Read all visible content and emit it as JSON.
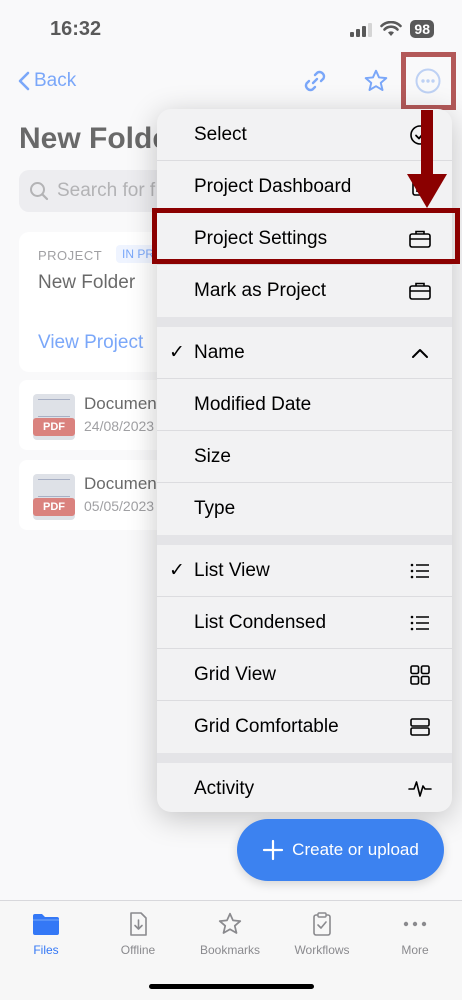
{
  "status_bar": {
    "time": "16:32",
    "battery": "98"
  },
  "nav": {
    "back_label": "Back"
  },
  "page": {
    "title": "New Folder"
  },
  "search": {
    "placeholder": "Search for f"
  },
  "project_card": {
    "label": "PROJECT",
    "badge": "IN PR",
    "name": "New Folder",
    "view_link": "View Project"
  },
  "documents": [
    {
      "name": "Documen",
      "date": "24/08/2023",
      "type": "PDF"
    },
    {
      "name": "Documen",
      "date": "05/05/2023",
      "type": "PDF"
    }
  ],
  "menu": {
    "group1": [
      {
        "label": "Select",
        "icon": "checkmark-circle-icon"
      },
      {
        "label": "Project Dashboard",
        "icon": "dashboard-icon"
      },
      {
        "label": "Project Settings",
        "icon": "briefcase-icon"
      },
      {
        "label": "Mark as Project",
        "icon": "briefcase-icon"
      }
    ],
    "group2": [
      {
        "label": "Name",
        "checked": true,
        "icon": "chevron-up-icon"
      },
      {
        "label": "Modified Date",
        "checked": false
      },
      {
        "label": "Size",
        "checked": false
      },
      {
        "label": "Type",
        "checked": false
      }
    ],
    "group3": [
      {
        "label": "List View",
        "checked": true,
        "icon": "list-icon"
      },
      {
        "label": "List Condensed",
        "checked": false,
        "icon": "list-icon"
      },
      {
        "label": "Grid View",
        "checked": false,
        "icon": "grid-icon"
      },
      {
        "label": "Grid Comfortable",
        "checked": false,
        "icon": "rows-icon"
      }
    ],
    "group4": [
      {
        "label": "Activity",
        "icon": "activity-icon"
      }
    ],
    "check_glyph": "✓"
  },
  "fab": {
    "label": "Create or upload"
  },
  "tabs": [
    {
      "label": "Files",
      "icon": "folder-icon",
      "active": true
    },
    {
      "label": "Offline",
      "icon": "download-doc-icon",
      "active": false
    },
    {
      "label": "Bookmarks",
      "icon": "star-icon",
      "active": false
    },
    {
      "label": "Workflows",
      "icon": "clipboard-icon",
      "active": false
    },
    {
      "label": "More",
      "icon": "ellipsis-icon",
      "active": false
    }
  ],
  "colors": {
    "accent": "#3478f6",
    "annotation": "#8b0000",
    "pdf": "#c7403a"
  }
}
